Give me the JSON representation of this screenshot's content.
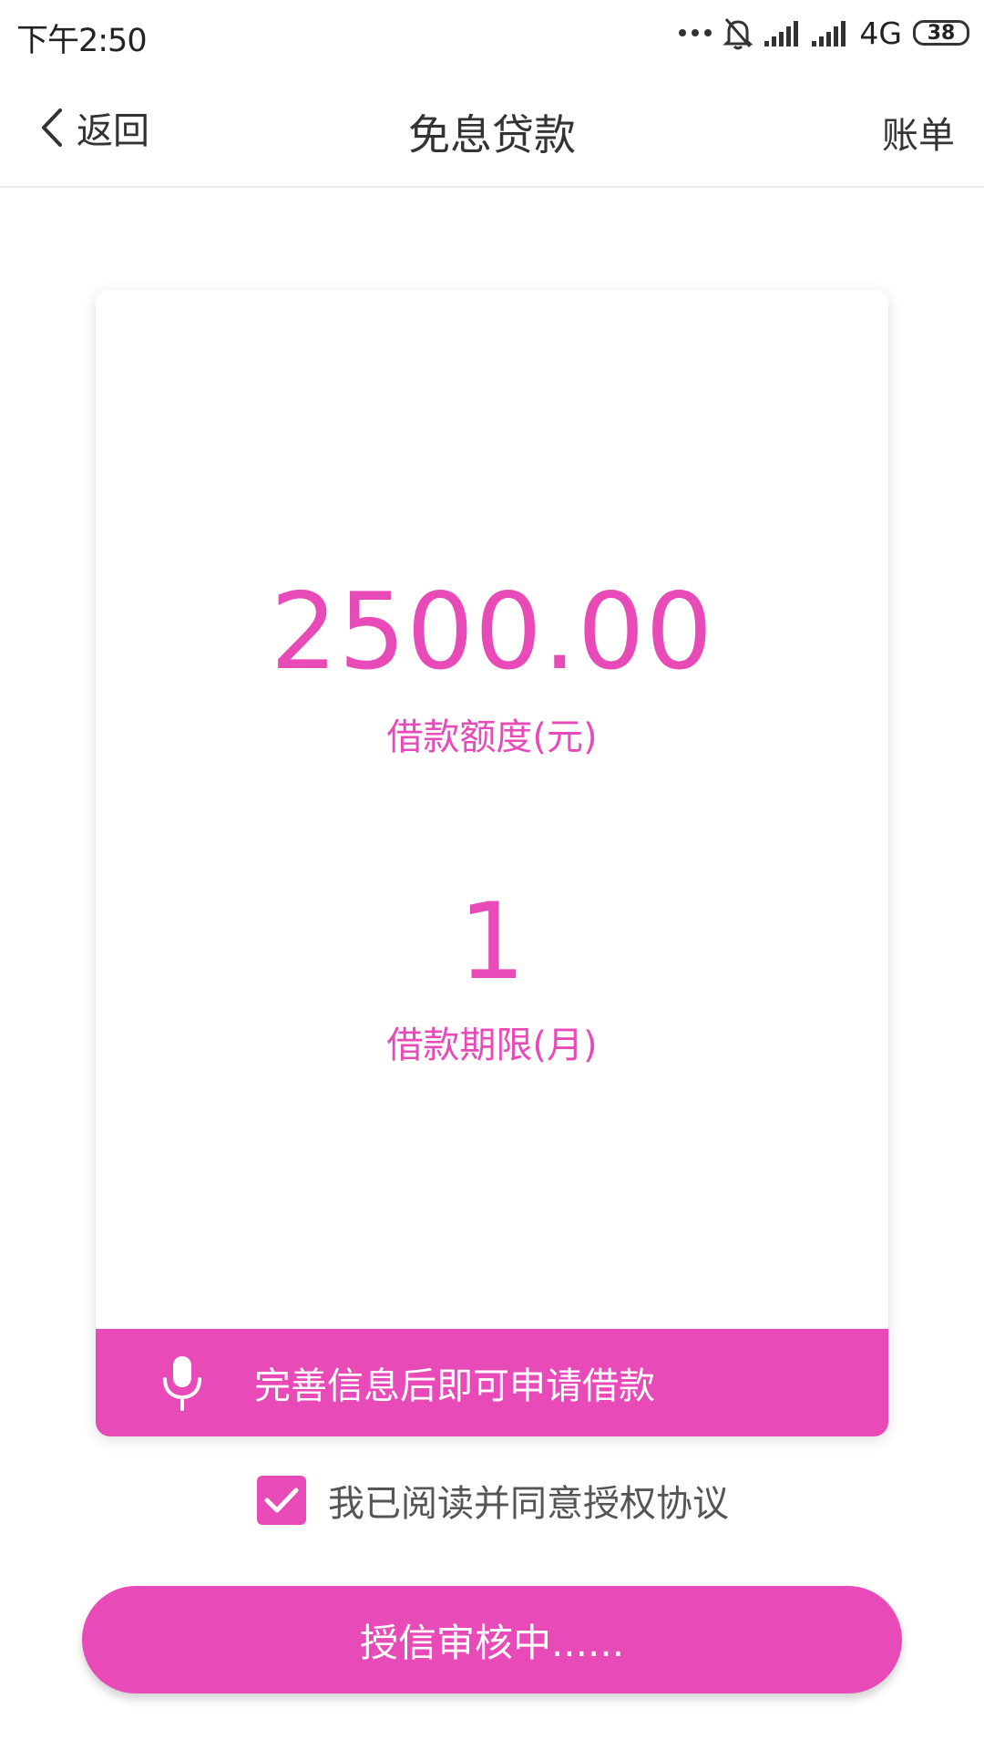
{
  "status_bar": {
    "time": "下午2:50",
    "network": "4G",
    "battery": "38",
    "icons": [
      "more-dots-icon",
      "bell-off-icon",
      "signal-icon",
      "signal-icon",
      "battery-icon"
    ]
  },
  "nav": {
    "back_label": "返回",
    "title": "免息贷款",
    "right_link": "账单"
  },
  "card": {
    "amount": "2500.00",
    "amount_label": "借款额度(元)",
    "term": "1",
    "term_label": "借款期限(月)",
    "banner_text": "完善信息后即可申请借款"
  },
  "agreement": {
    "checked": true,
    "text": "我已阅读并同意授权协议"
  },
  "submit": {
    "label": "授信审核中......"
  },
  "colors": {
    "accent": "#e84bb8"
  }
}
